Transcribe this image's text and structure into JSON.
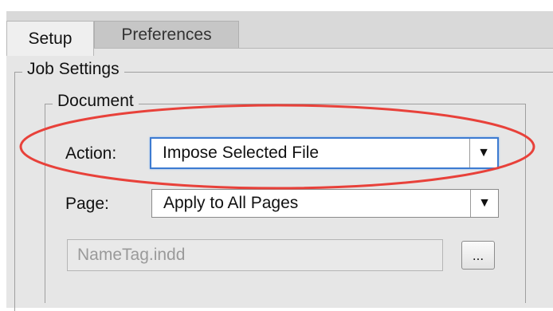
{
  "tabs": [
    {
      "label": "Setup",
      "active": true
    },
    {
      "label": "Preferences",
      "active": false
    }
  ],
  "groups": {
    "job_settings_label": "Job Settings",
    "document_label": "Document"
  },
  "fields": {
    "action_label": "Action:",
    "action_value": "Impose Selected File",
    "page_label": "Page:",
    "page_value": "Apply to All Pages",
    "file_value": "NameTag.indd",
    "browse_label": "..."
  },
  "icons": {
    "dropdown_arrow": "▼"
  },
  "colors": {
    "highlight_ellipse": "#e8413a",
    "focus_border": "#3d7bd1"
  }
}
